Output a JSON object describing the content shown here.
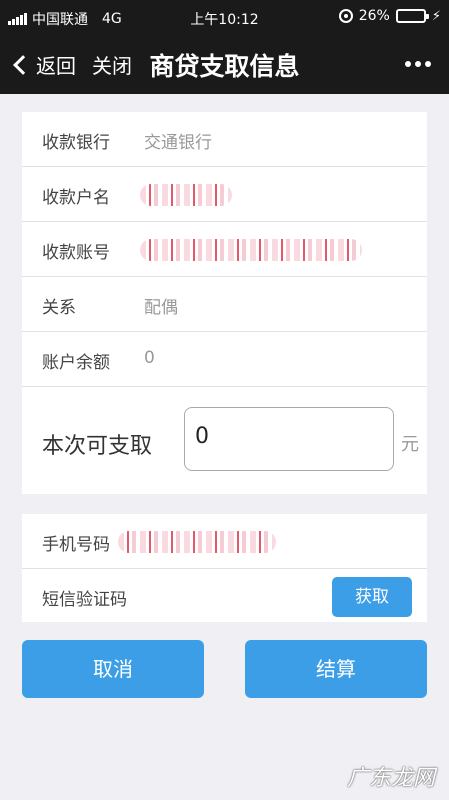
{
  "status_bar": {
    "carrier": "中国联通",
    "network": "4G",
    "time": "上午10:12",
    "battery_percent": "26%",
    "battery_level": 0.26
  },
  "nav": {
    "back_label": "返回",
    "close_label": "关闭",
    "title": "商贷支取信息"
  },
  "info": {
    "bank_label": "收款银行",
    "bank_value": "交通银行",
    "name_label": "收款户名",
    "account_label": "收款账号",
    "relation_label": "关系",
    "relation_value": "配偶",
    "balance_label": "账户余额",
    "balance_value": "0",
    "amount_label": "本次可支取",
    "amount_value": "0",
    "amount_unit": "元"
  },
  "verify": {
    "phone_label": "手机号码",
    "sms_label": "短信验证码",
    "get_code_label": "获取"
  },
  "actions": {
    "cancel_label": "取消",
    "settle_label": "结算"
  },
  "watermark": "广东龙网",
  "colors": {
    "accent": "#3d9ee8",
    "header_bg": "#1a1a1a",
    "page_bg": "#efeff4"
  }
}
